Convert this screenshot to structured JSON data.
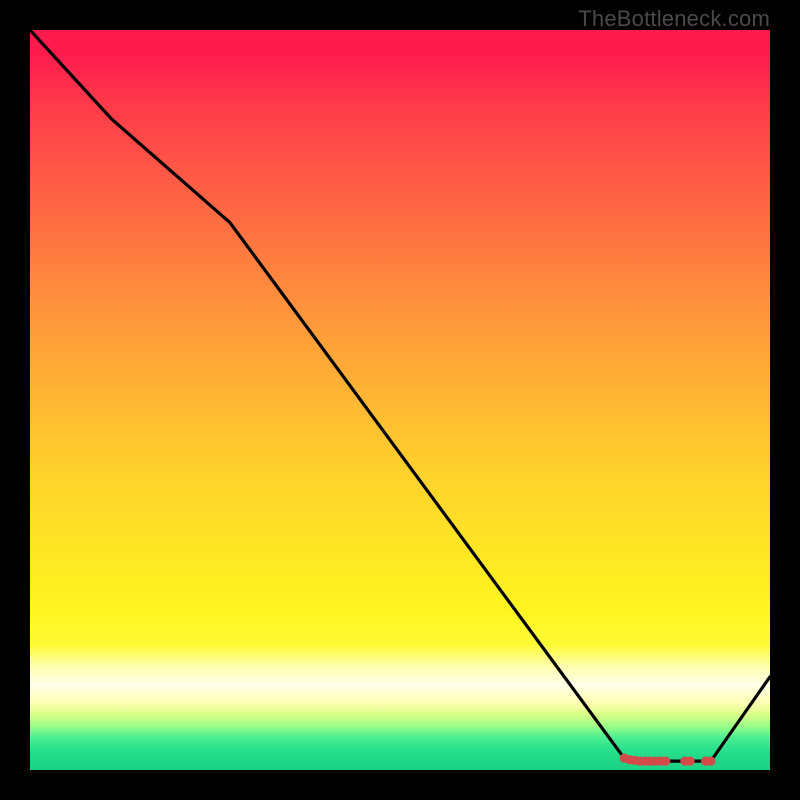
{
  "attribution": "TheBottleneck.com",
  "colors": {
    "line": "#000000",
    "marker_fill": "#d44a4a",
    "marker_stroke": "#d44a4a",
    "background_top": "#ff1a4d",
    "background_bottom": "#1ad084",
    "frame": "#000000"
  },
  "chart_data": {
    "type": "line",
    "title": "",
    "xlabel": "",
    "ylabel": "",
    "xlim": [
      0,
      100
    ],
    "ylim": [
      0,
      100
    ],
    "note": "No numeric axis ticks are shown; x and y are normalized 0–100 from pixel positions. Line is the black bottleneck curve; markers are the red points near the minimum.",
    "series": [
      {
        "name": "curve",
        "kind": "line",
        "x": [
          0,
          11,
          27,
          80.3,
          83.1,
          85.9,
          89.2,
          92.0,
          100
        ],
        "y": [
          100,
          88,
          74,
          1.6,
          1.2,
          1.2,
          1.2,
          1.2,
          12.6
        ]
      },
      {
        "name": "markers",
        "kind": "scatter",
        "x": [
          80.3,
          81.0,
          81.7,
          82.4,
          83.1,
          83.8,
          84.5,
          85.2,
          85.9,
          88.5,
          89.2,
          91.3,
          92.0
        ],
        "y": [
          1.6,
          1.4,
          1.3,
          1.2,
          1.2,
          1.2,
          1.2,
          1.2,
          1.2,
          1.2,
          1.2,
          1.2,
          1.2
        ]
      }
    ]
  }
}
